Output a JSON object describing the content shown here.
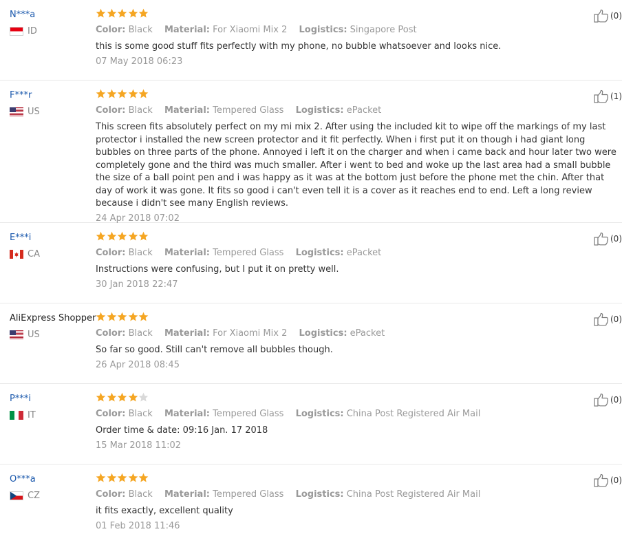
{
  "labels": {
    "color": "Color:",
    "material": "Material:",
    "logistics": "Logistics:"
  },
  "colors": {
    "star_on": "#f5a623",
    "star_off": "#d9d9d9",
    "username": "#1a58ac",
    "muted": "#999999"
  },
  "reviews": [
    {
      "user": "N***a",
      "country": "ID",
      "flag": "flag-indonesia-icon",
      "rating": 5,
      "color": "Black",
      "material": "For Xiaomi Mix 2",
      "logistics": "Singapore Post",
      "text": "this is some good stuff fits perfectly with my phone, no bubble whatsoever and looks nice.",
      "date": "07 May 2018 06:23",
      "helpful": "(0)"
    },
    {
      "user": "F***r",
      "country": "US",
      "flag": "flag-usa-icon",
      "rating": 5,
      "color": "Black",
      "material": "Tempered Glass",
      "logistics": "ePacket",
      "text": "This screen fits absolutely perfect on my mi mix 2. After using the included kit to wipe off the markings of my last protector i installed the new screen protector and it fit perfectly. When i first put it on though i had giant long bubbles on three parts of the phone. Annoyed i left it on the charger and when i came back and hour later two were completely gone and the third was much smaller. After i went to bed and woke up the last area had a small bubble the size of a ball point pen and i was happy as it was at the bottom just before the phone met the chin. After that day of work it was gone. It fits so good i can't even tell it is a cover as it reaches end to end. Left a long review because i didn't see many English reviews.",
      "date": "24 Apr 2018 07:02",
      "helpful": "(1)"
    },
    {
      "user": "E***i",
      "country": "CA",
      "flag": "flag-canada-icon",
      "rating": 5,
      "color": "Black",
      "material": "Tempered Glass",
      "logistics": "ePacket",
      "text": "Instructions were confusing, but I put it on pretty well.",
      "date": "30 Jan 2018 22:47",
      "helpful": "(0)"
    },
    {
      "user": "AliExpress Shopper",
      "country": "US",
      "flag": "flag-usa-icon",
      "rating": 5,
      "color": "Black",
      "material": "For Xiaomi Mix 2",
      "logistics": "ePacket",
      "text": "So far so good. Still can't remove all bubbles though.",
      "date": "26 Apr 2018 08:45",
      "helpful": "(0)"
    },
    {
      "user": "P***i",
      "country": "IT",
      "flag": "flag-italy-icon",
      "rating": 4,
      "color": "Black",
      "material": "Tempered Glass",
      "logistics": "China Post Registered Air Mail",
      "text": "Order time & date: 09:16 Jan. 17 2018",
      "date": "15 Mar 2018 11:02",
      "helpful": "(0)"
    },
    {
      "user": "O***a",
      "country": "CZ",
      "flag": "flag-czech-icon",
      "rating": 5,
      "color": "Black",
      "material": "Tempered Glass",
      "logistics": "China Post Registered Air Mail",
      "text": "it fits exactly, excellent quality",
      "date": "01 Feb 2018 11:46",
      "helpful": "(0)"
    }
  ]
}
